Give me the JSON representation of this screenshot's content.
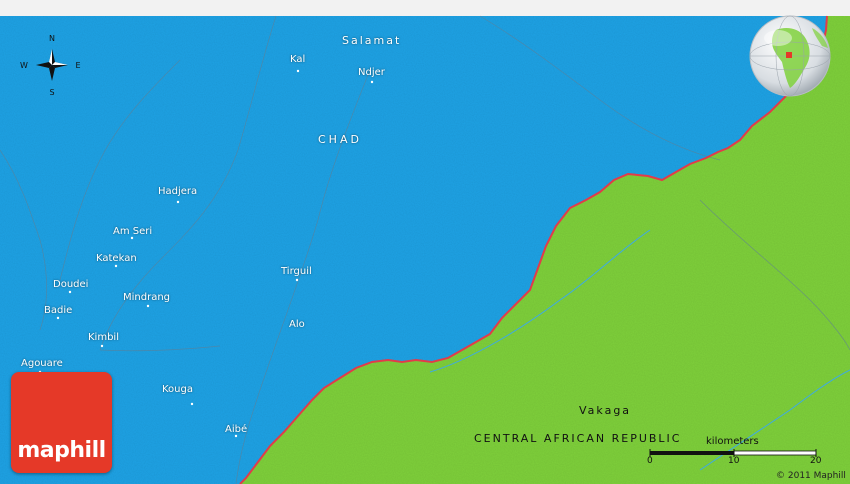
{
  "map": {
    "colors": {
      "chad": "#1ea3e6",
      "car": "#7fd13b",
      "border": "#e23b4a",
      "top_band": "#f2f2f2",
      "water": "#3da9e8"
    }
  },
  "compass": {
    "n": "N",
    "s": "S",
    "e": "E",
    "w": "W"
  },
  "labels": {
    "salamat": "Salamat",
    "kal": "Kal",
    "ndjer": "Ndjer",
    "chad": "CHAD",
    "hadjera": "Hadjera",
    "am_seri": "Am Seri",
    "katekan": "Katekan",
    "doudei": "Doudei",
    "mindrang": "Mindrang",
    "tirguil": "Tirguil",
    "badie": "Badie",
    "alo": "Alo",
    "kimbil": "Kimbil",
    "agouare": "Agouare",
    "kouga": "Kouga",
    "aibe": "Aibé",
    "vakaga": "Vakaga",
    "car": "CENTRAL AFRICAN REPUBLIC"
  },
  "scale": {
    "unit": "kilometers",
    "ticks": [
      "0",
      "10",
      "20"
    ]
  },
  "copyright": "© 2011 Maphill",
  "logo": "maphill"
}
